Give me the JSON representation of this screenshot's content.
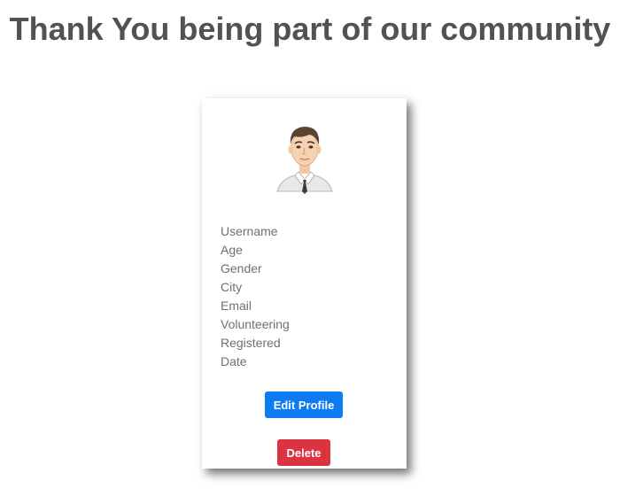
{
  "page": {
    "heading": "Thank You being part of our community"
  },
  "profile_card": {
    "fields": [
      "Username",
      "Age",
      "Gender",
      "City",
      "Email",
      "Volunteering",
      "Registered",
      "Date"
    ],
    "edit_label": "Edit Profile",
    "delete_label": "Delete"
  },
  "colors": {
    "heading": "#525252",
    "field_text": "#707070",
    "edit_button": "#0d7cf2",
    "delete_button": "#db3340"
  },
  "icons": {
    "avatar": "male-avatar-icon"
  }
}
